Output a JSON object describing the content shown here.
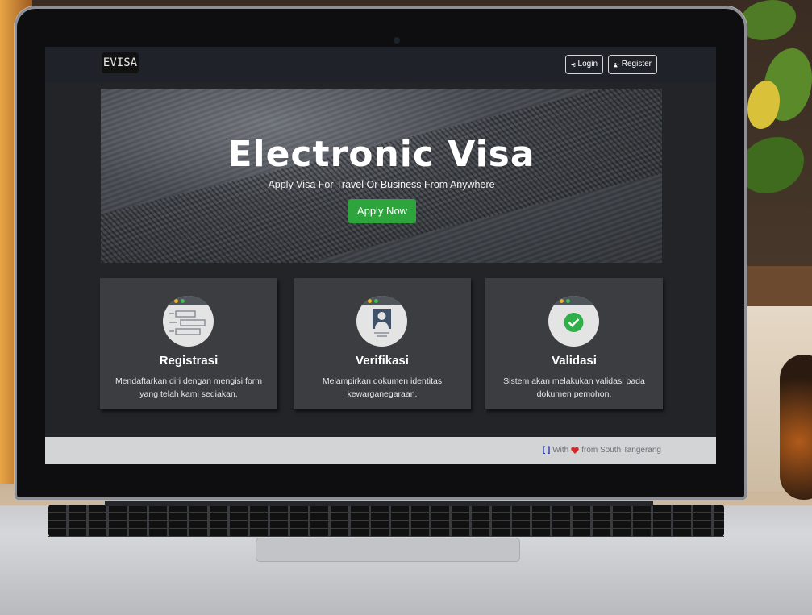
{
  "navbar": {
    "brand": "EVISA",
    "login_label": "Login",
    "register_label": "Register"
  },
  "hero": {
    "title": "Electronic Visa",
    "subtitle": "Apply Visa For Travel Or Business From Anywhere",
    "cta_label": "Apply Now"
  },
  "cards": [
    {
      "title": "Registrasi",
      "text": "Mendaftarkan diri dengan mengisi form yang telah kami sediakan.",
      "icon": "form-icon"
    },
    {
      "title": "Verifikasi",
      "text": "Melampirkan dokumen identitas kewarganegaraan.",
      "icon": "user-id-icon"
    },
    {
      "title": "Validasi",
      "text": "Sistem akan melakukan validasi pada dokumen pemohon.",
      "icon": "check-circle-icon"
    }
  ],
  "footer": {
    "brackets": "[ ]",
    "with": "With",
    "from": "from South Tangerang"
  },
  "colors": {
    "accent_green": "#2ea43c",
    "navbar_bg": "#1f2329",
    "card_bg": "#3b3d40",
    "heart": "#d62828",
    "bracket_blue": "#1a2db3"
  }
}
